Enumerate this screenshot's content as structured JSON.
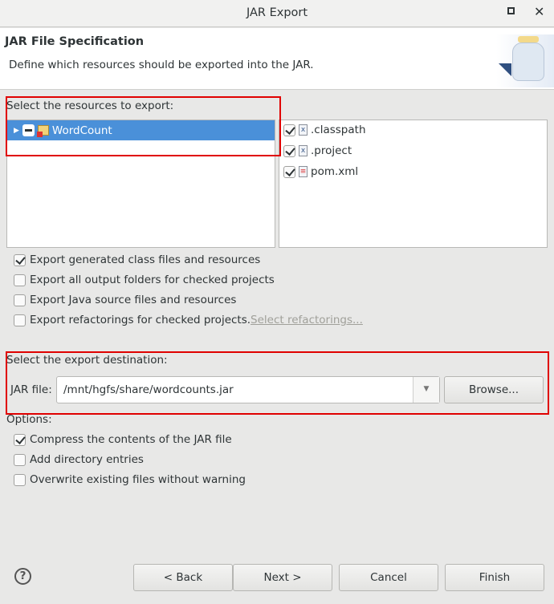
{
  "window": {
    "title": "JAR Export",
    "maximize_icon": "maximize-icon",
    "close_icon": "close-icon"
  },
  "header": {
    "title": "JAR File Specification",
    "description": "Define which resources should be exported into the JAR."
  },
  "resources": {
    "label": "Select the resources to export:",
    "tree": [
      {
        "label": "WordCount",
        "selected": true,
        "checked": "partial"
      }
    ],
    "files": [
      {
        "label": ".classpath",
        "checked": true
      },
      {
        "label": ".project",
        "checked": true
      },
      {
        "label": "pom.xml",
        "checked": true
      }
    ]
  },
  "export_options": [
    {
      "label": "Export generated class files and resources",
      "checked": true
    },
    {
      "label": "Export all output folders for checked projects",
      "checked": false
    },
    {
      "label": "Export Java source files and resources",
      "checked": false
    },
    {
      "label": "Export refactorings for checked projects.",
      "checked": false,
      "link": "Select refactorings..."
    }
  ],
  "destination": {
    "label": "Select the export destination:",
    "jar_label": "JAR file:",
    "jar_value": "/mnt/hgfs/share/wordcounts.jar",
    "browse": "Browse..."
  },
  "options": {
    "label": "Options:",
    "items": [
      {
        "label": "Compress the contents of the JAR file",
        "checked": true
      },
      {
        "label": "Add directory entries",
        "checked": false
      },
      {
        "label": "Overwrite existing files without warning",
        "checked": false
      }
    ]
  },
  "buttons": {
    "help": "?",
    "back": "< Back",
    "next": "Next >",
    "cancel": "Cancel",
    "finish": "Finish"
  },
  "colors": {
    "selection": "#4a90d9",
    "annotation": "#e00000"
  }
}
